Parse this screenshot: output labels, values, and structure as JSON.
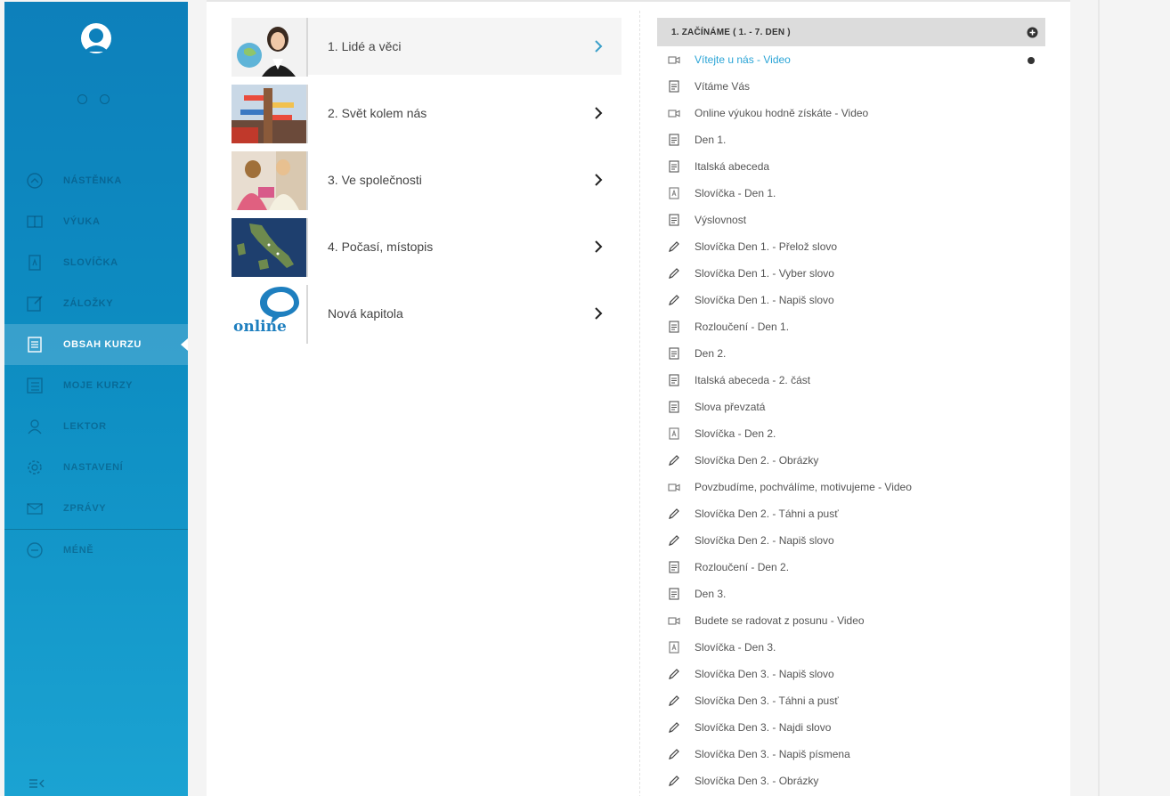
{
  "sidebar": {
    "nav": [
      {
        "id": "nastenka",
        "label": "NÁSTĚNKA",
        "icon": "dashboard-icon"
      },
      {
        "id": "vyuka",
        "label": "VÝUKA",
        "icon": "book-icon"
      },
      {
        "id": "slovicka",
        "label": "SLOVÍČKA",
        "icon": "vocabulary-card-icon"
      },
      {
        "id": "zalozky",
        "label": "ZÁLOŽKY",
        "icon": "bookmark-edit-icon"
      },
      {
        "id": "obsah",
        "label": "OBSAH KURZU",
        "icon": "document-list-icon"
      },
      {
        "id": "moje",
        "label": "MOJE KURZY",
        "icon": "checklist-icon"
      },
      {
        "id": "lektor",
        "label": "LEKTOR",
        "icon": "person-icon"
      },
      {
        "id": "nastaveni",
        "label": "NASTAVENÍ",
        "icon": "gear-icon"
      },
      {
        "id": "zpravy",
        "label": "ZPRÁVY",
        "icon": "envelope-icon"
      },
      {
        "id": "mene",
        "label": "MÉNĚ",
        "icon": "minus-circle-icon"
      }
    ],
    "active_item": "OBSAH KURZU"
  },
  "chapters": [
    {
      "title": "1. Lidé a věci",
      "active": true
    },
    {
      "title": "2. Svět kolem nás",
      "active": false
    },
    {
      "title": "3. Ve společnosti",
      "active": false
    },
    {
      "title": "4. Počasí, místopis",
      "active": false
    },
    {
      "title": "Nová kapitola",
      "active": false
    }
  ],
  "online_logo_text": "online",
  "lesson_section": {
    "header": "1. ZAČÍNÁME ( 1. - 7. DEN )",
    "items": [
      {
        "label": "Vítejte u nás - Video",
        "type": "video",
        "current": true
      },
      {
        "label": "Vítáme Vás",
        "type": "document"
      },
      {
        "label": "Online výukou hodně získáte - Video",
        "type": "video"
      },
      {
        "label": "Den 1.",
        "type": "document"
      },
      {
        "label": "Italská abeceda",
        "type": "document"
      },
      {
        "label": "Slovíčka - Den 1.",
        "type": "vocabulary"
      },
      {
        "label": "Výslovnost",
        "type": "document"
      },
      {
        "label": "Slovíčka Den 1. - Přelož slovo",
        "type": "exercise"
      },
      {
        "label": "Slovíčka Den 1. - Vyber slovo",
        "type": "exercise"
      },
      {
        "label": "Slovíčka Den 1. - Napiš slovo",
        "type": "exercise"
      },
      {
        "label": "Rozloučení - Den 1.",
        "type": "document"
      },
      {
        "label": "Den 2.",
        "type": "document"
      },
      {
        "label": "Italská abeceda - 2. část",
        "type": "document"
      },
      {
        "label": "Slova převzatá",
        "type": "document"
      },
      {
        "label": "Slovíčka - Den 2.",
        "type": "vocabulary"
      },
      {
        "label": "Slovíčka Den 2. - Obrázky",
        "type": "exercise"
      },
      {
        "label": "Povzbudíme, pochválíme, motivujeme - Video",
        "type": "video"
      },
      {
        "label": "Slovíčka Den 2. - Táhni a pusť",
        "type": "exercise"
      },
      {
        "label": "Slovíčka Den 2. - Napiš slovo",
        "type": "exercise"
      },
      {
        "label": "Rozloučení - Den 2.",
        "type": "document"
      },
      {
        "label": "Den 3.",
        "type": "document"
      },
      {
        "label": "Budete se radovat z posunu - Video",
        "type": "video"
      },
      {
        "label": "Slovíčka - Den 3.",
        "type": "vocabulary"
      },
      {
        "label": "Slovíčka Den 3. - Napiš slovo",
        "type": "exercise"
      },
      {
        "label": "Slovíčka Den 3. - Táhni a pusť",
        "type": "exercise"
      },
      {
        "label": "Slovíčka Den 3. - Najdi slovo",
        "type": "exercise"
      },
      {
        "label": "Slovíčka Den 3. - Napiš písmena",
        "type": "exercise"
      },
      {
        "label": "Slovíčka Den 3. - Obrázky",
        "type": "exercise"
      }
    ]
  },
  "colors": {
    "sidebar": "#0d80bb",
    "accent": "#2aa4d6",
    "header_bg": "#dcdcdc"
  }
}
